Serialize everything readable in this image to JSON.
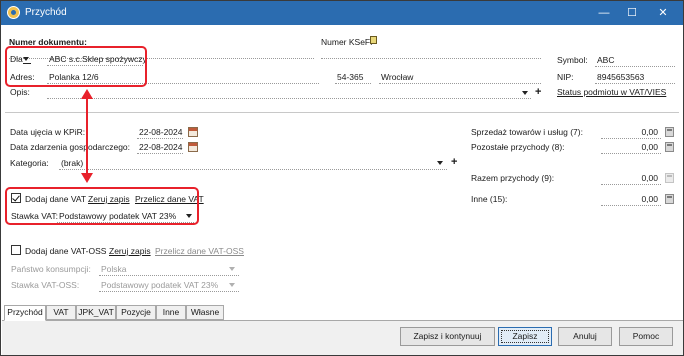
{
  "window": {
    "title": "Przychód",
    "minimize": "—",
    "maximize": "☐",
    "close": "✕"
  },
  "document": {
    "number_label": "Numer dokumentu:",
    "number_value": "",
    "ksef_label": "Numer KSeF:",
    "ksef_value": ""
  },
  "contractor": {
    "dla_label": "Dla",
    "name": "ABC s.c.Sklep spożywczy",
    "address_label": "Adres:",
    "street": "Polanka 12/6",
    "postal_code": "54-365",
    "city": "Wrocław",
    "symbol_label": "Symbol:",
    "symbol": "ABC",
    "nip_label": "NIP:",
    "nip": "8945653563",
    "vat_status_link": "Status podmiotu w VAT/VIES"
  },
  "description": {
    "label": "Opis:",
    "value": ""
  },
  "dates": {
    "kpir_label": "Data ujęcia w KPiR:",
    "kpir_value": "22-08-2024",
    "event_label": "Data zdarzenia gospodarczego:",
    "event_value": "22-08-2024",
    "category_label": "Kategoria:",
    "category_value": "(brak)"
  },
  "vat": {
    "checkbox_label": "Dodaj dane VAT",
    "checked": true,
    "reset_link": "Zeruj zapis",
    "recalc_link": "Przelicz dane VAT",
    "rate_label": "Stawka VAT:",
    "rate_value": "Podstawowy podatek VAT 23%"
  },
  "vat_oss": {
    "checkbox_label": "Dodaj dane VAT-OSS",
    "checked": false,
    "reset_link": "Zeruj zapis",
    "recalc_link": "Przelicz dane VAT-OSS",
    "country_label": "Państwo konsumpcji:",
    "country_value": "Polska",
    "rate_label": "Stawka VAT-OSS:",
    "rate_value": "Podstawowy podatek VAT 23%"
  },
  "amounts": {
    "sales_label": "Sprzedaż towarów i usług (7):",
    "sales_value": "0,00",
    "other_label": "Pozostałe przychody (8):",
    "other_value": "0,00",
    "total_label": "Razem przychody (9):",
    "total_value": "0,00",
    "misc_label": "Inne (15):",
    "misc_value": "0,00"
  },
  "tabs": [
    "Przychód",
    "VAT",
    "JPK_VAT",
    "Pozycje",
    "Inne",
    "Własne"
  ],
  "buttons": {
    "save_continue": "Zapisz i kontynuuj",
    "save": "Zapisz",
    "cancel": "Anuluj",
    "help": "Pomoc"
  },
  "colors": {
    "titlebar": "#2b6cb0",
    "highlight": "#e8212b"
  }
}
